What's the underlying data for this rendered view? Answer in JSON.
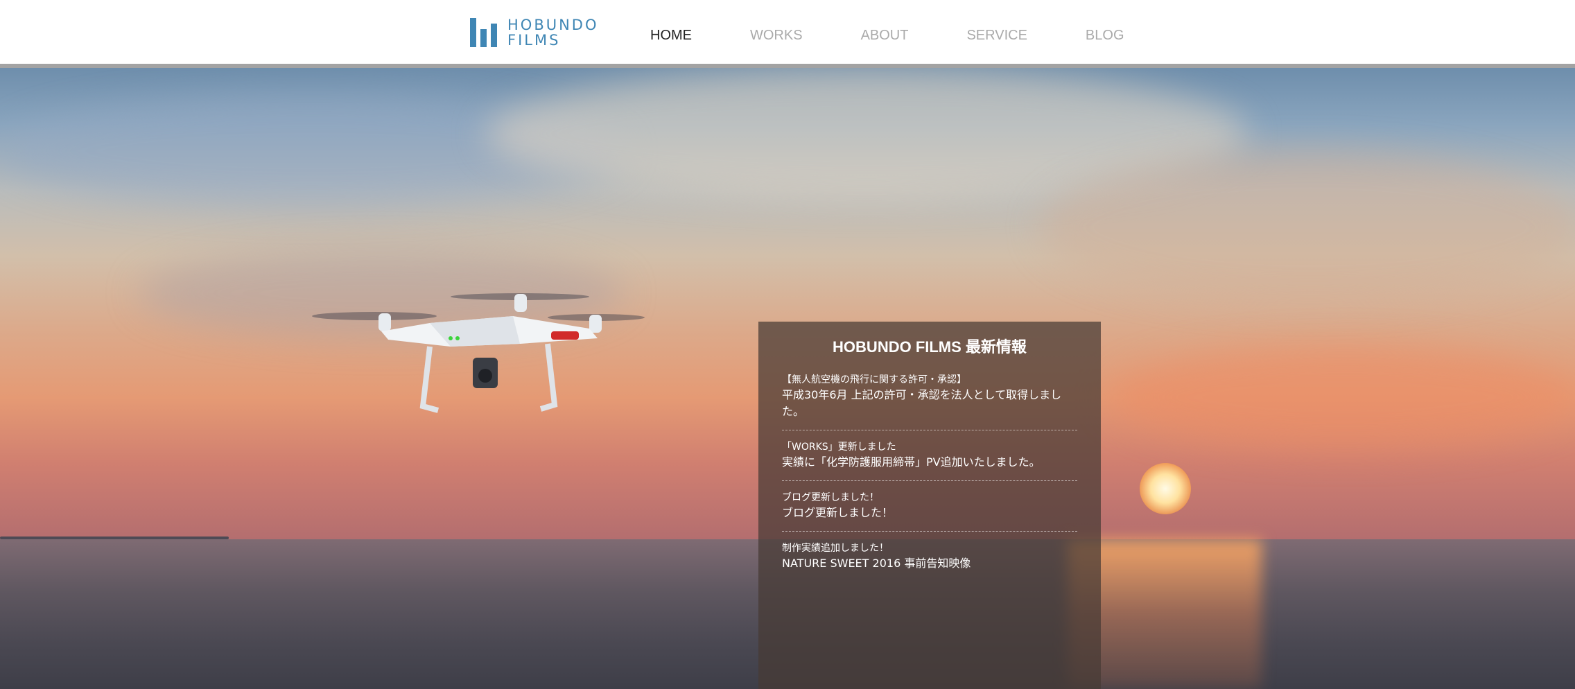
{
  "header": {
    "logo": {
      "line1": "HOBUNDO",
      "line2": "FILMS",
      "color": "#3f86b4"
    },
    "nav": [
      {
        "label": "HOME",
        "active": true
      },
      {
        "label": "WORKS",
        "active": false
      },
      {
        "label": "ABOUT",
        "active": false
      },
      {
        "label": "SERVICE",
        "active": false
      },
      {
        "label": "BLOG",
        "active": false
      }
    ]
  },
  "news": {
    "title": "HOBUNDO FILMS 最新情報",
    "items": [
      {
        "caption": "【無人航空機の飛行に関する許可・承認】",
        "body": "平成30年6月 上記の許可・承認を法人として取得しました。"
      },
      {
        "caption": "「WORKS」更新しました",
        "body": "実績に「化学防護服用締帯」PV追加いたしました。"
      },
      {
        "caption": "ブログ更新しました！",
        "body": "ブログ更新しました！"
      },
      {
        "caption": "制作実績追加しました！",
        "body": "NATURE SWEET 2016 事前告知映像"
      }
    ]
  },
  "colors": {
    "accent": "#3f86b4",
    "nav_inactive": "#aaaaaa",
    "nav_active": "#222222"
  }
}
